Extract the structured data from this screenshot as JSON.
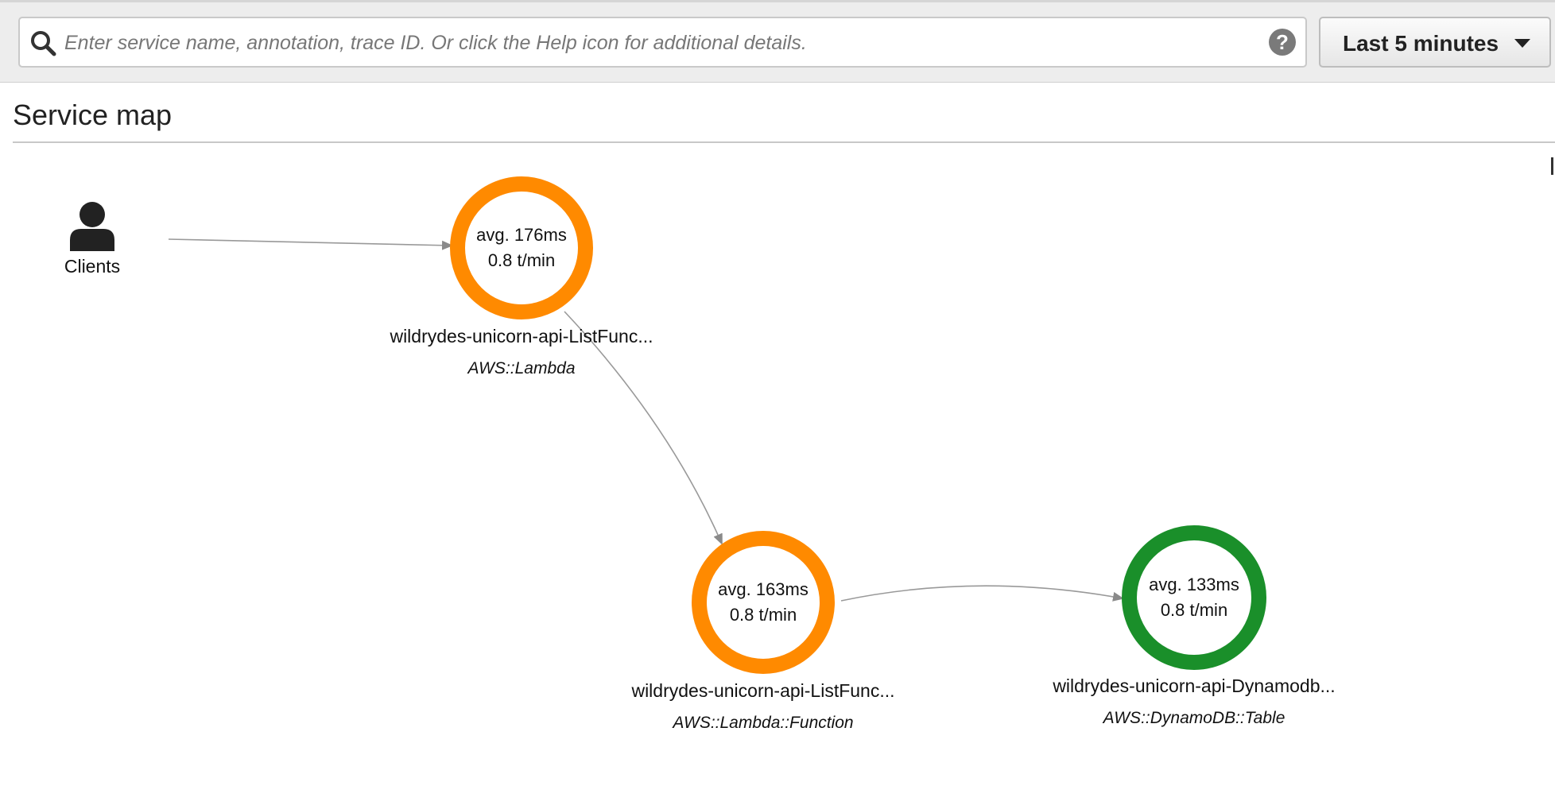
{
  "search": {
    "placeholder": "Enter service name, annotation, trace ID. Or click the Help icon for additional details.",
    "value": ""
  },
  "help": {
    "glyph": "?"
  },
  "time_range": {
    "label": "Last 5 minutes"
  },
  "page": {
    "title": "Service map"
  },
  "colors": {
    "ok": "#1a8f2a",
    "warning": "#ff8a00",
    "edge": "#999999"
  },
  "map": {
    "clients": {
      "label": "Clients",
      "icon": "user-icon"
    },
    "nodes": [
      {
        "avg": "avg. 176ms",
        "rate": "0.8 t/min",
        "name": "wildrydes-unicorn-api-ListFunc...",
        "type": "AWS::Lambda",
        "status": "warning"
      },
      {
        "avg": "avg. 163ms",
        "rate": "0.8 t/min",
        "name": "wildrydes-unicorn-api-ListFunc...",
        "type": "AWS::Lambda::Function",
        "status": "warning"
      },
      {
        "avg": "avg. 133ms",
        "rate": "0.8 t/min",
        "name": "wildrydes-unicorn-api-Dynamodb...",
        "type": "AWS::DynamoDB::Table",
        "status": "ok"
      }
    ]
  }
}
